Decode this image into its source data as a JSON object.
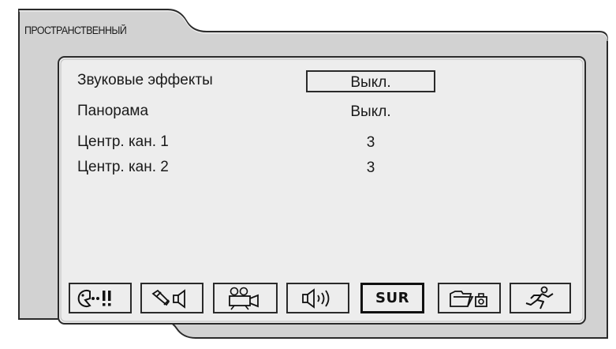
{
  "panel": {
    "title": "ПРОСТРАНСТВЕННЫЙ"
  },
  "settings": [
    {
      "label": "Звуковые эффекты",
      "value": "Выкл.",
      "selected": true
    },
    {
      "label": "Панорама",
      "value": "Выкл.",
      "selected": false
    },
    {
      "label": "Центр. кан. 1",
      "value": "3",
      "selected": false
    },
    {
      "label": "Центр. кан. 2",
      "value": "3",
      "selected": false
    }
  ],
  "tabs": [
    {
      "id": "general",
      "icon": "face-exclaim-icon",
      "active": false
    },
    {
      "id": "speaker-setup",
      "icon": "wrench-speaker-icon",
      "active": false
    },
    {
      "id": "video",
      "icon": "camera-icon",
      "active": false
    },
    {
      "id": "audio",
      "icon": "speaker-icon",
      "active": false
    },
    {
      "id": "surround",
      "label": "SUR",
      "active": true
    },
    {
      "id": "media",
      "icon": "folder-camera-icon",
      "active": false
    },
    {
      "id": "exit",
      "icon": "running-man-icon",
      "active": false
    }
  ],
  "colors": {
    "panel_bg": "#d2d2d2",
    "content_bg": "#ededed",
    "border": "#2a2a2a"
  }
}
